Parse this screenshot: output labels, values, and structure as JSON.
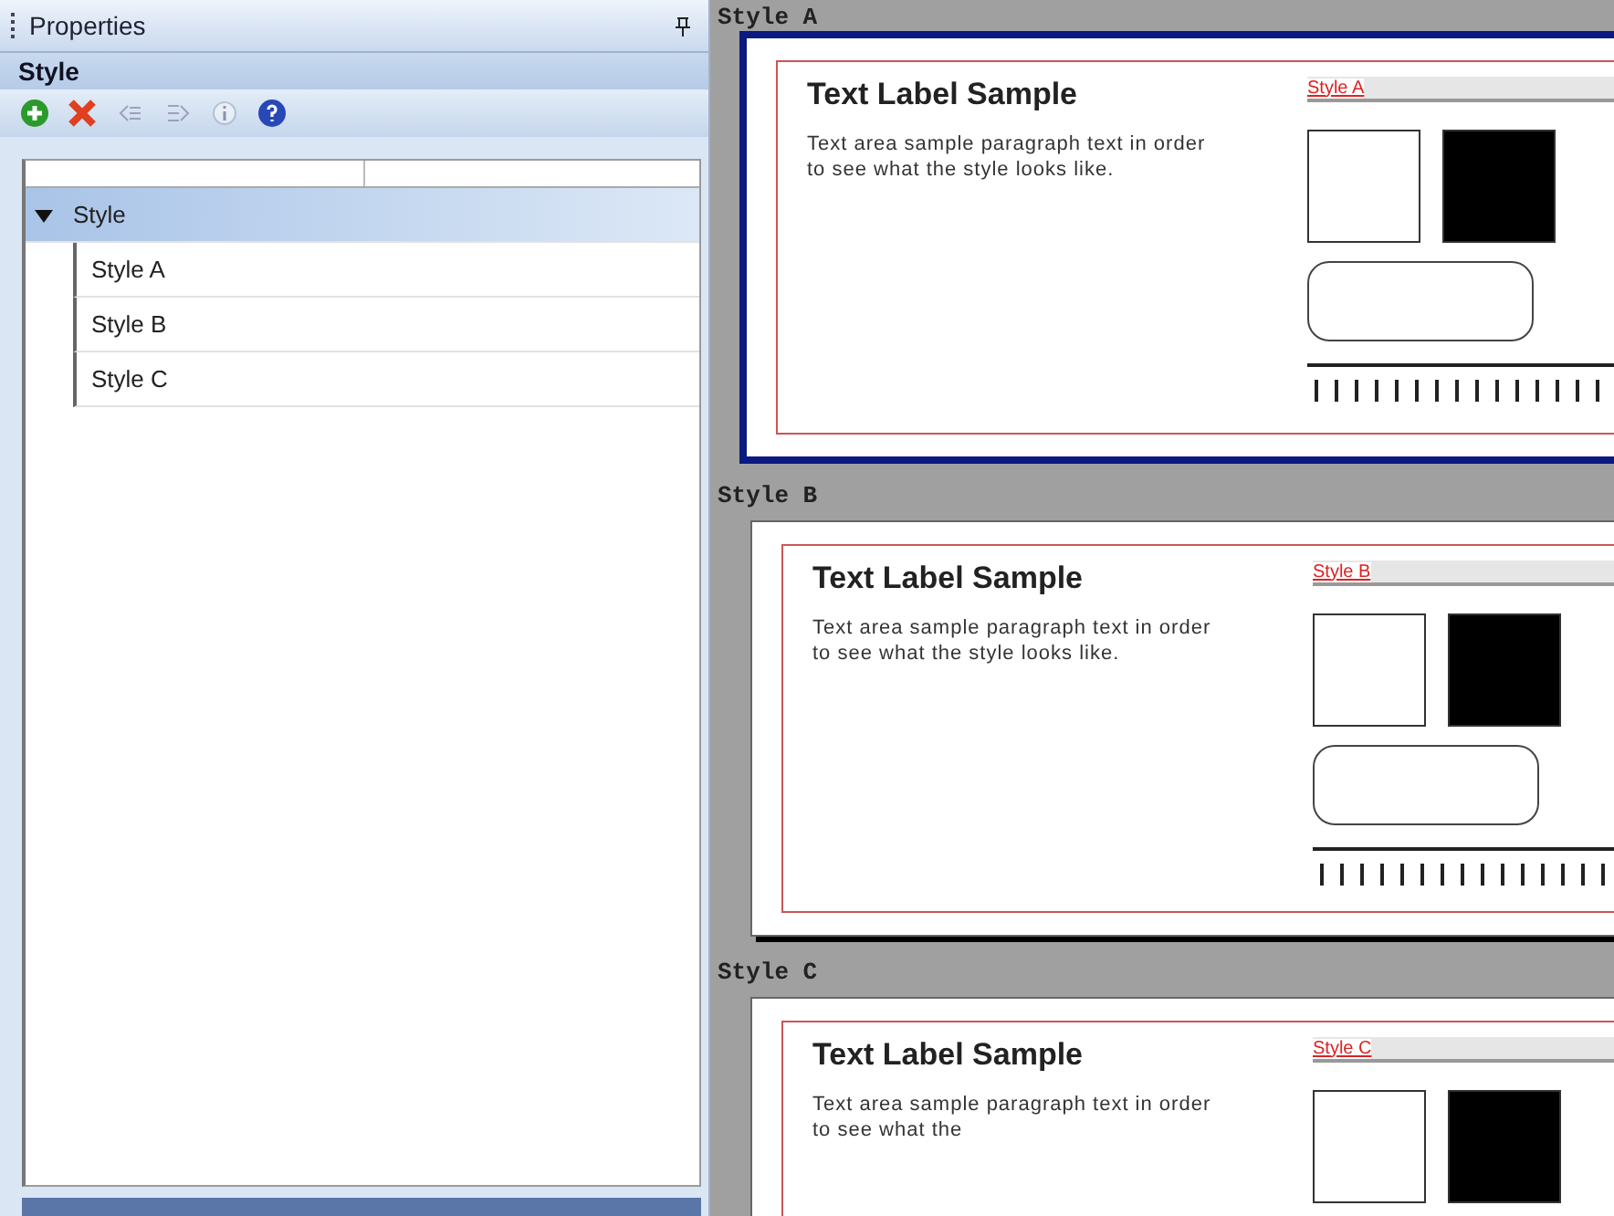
{
  "panel": {
    "title": "Properties",
    "section": "Style",
    "toolbar": [
      {
        "kind": "add",
        "disabled": false
      },
      {
        "kind": "delete",
        "disabled": false
      },
      {
        "kind": "outdent",
        "disabled": true
      },
      {
        "kind": "indent",
        "disabled": true
      },
      {
        "kind": "info",
        "disabled": true
      },
      {
        "kind": "help",
        "disabled": false
      }
    ],
    "tree": [
      {
        "label": "Style",
        "expanded": true,
        "selected": true,
        "children": [
          {
            "label": "Style A",
            "selected": false
          },
          {
            "label": "Style B",
            "selected": false
          },
          {
            "label": "Style C",
            "selected": false
          }
        ]
      }
    ]
  },
  "canvas": {
    "styles": [
      {
        "name": "Style A",
        "selected": true,
        "heading": "Text Label Sample",
        "paragraph": "Text area sample paragraph text in order to see what the style looks like.",
        "link": "Style A"
      },
      {
        "name": "Style B",
        "selected": false,
        "heading": "Text Label Sample",
        "paragraph": "Text area sample paragraph text in order to see what the style looks like.",
        "link": "Style B"
      },
      {
        "name": "Style C",
        "selected": false,
        "heading": "Text Label Sample",
        "paragraph": "Text area sample paragraph text in order to see what the",
        "link": "Style C"
      }
    ]
  }
}
